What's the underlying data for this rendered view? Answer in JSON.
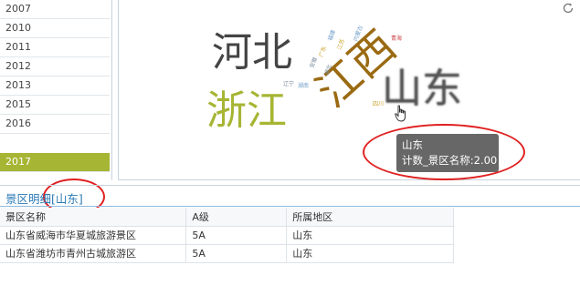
{
  "years": [
    {
      "label": "2007",
      "selected": false
    },
    {
      "label": "2010",
      "selected": false
    },
    {
      "label": "2011",
      "selected": false
    },
    {
      "label": "2012",
      "selected": false
    },
    {
      "label": "2013",
      "selected": false
    },
    {
      "label": "2015",
      "selected": false
    },
    {
      "label": "2016",
      "selected": false
    },
    {
      "label": "2017",
      "selected": true
    }
  ],
  "cloud": {
    "words": {
      "hebei": "河北",
      "zhejiang": "浙江",
      "jiangxi": "江西",
      "shandong": "山东",
      "small_1": "江苏",
      "small_2": "福建",
      "small_3": "广东",
      "small_4": "安徽",
      "small_5": "内蒙古",
      "small_6": "辽宁",
      "small_7": "湖南",
      "small_8": "青海",
      "small_9": "四川",
      "small_10": "湖北"
    },
    "colors": {
      "hebei": "#444444",
      "zhejiang": "#a7b534",
      "jiangxi": "#9a6a12",
      "shandong": "#555555"
    }
  },
  "tooltip": {
    "name": "山东",
    "metric": "计数_景区名称:2.00"
  },
  "detail": {
    "title": "景区明细[山东]",
    "columns": [
      "景区名称",
      "A级",
      "所属地区"
    ],
    "rows": [
      [
        "山东省威海市华夏城旅游景区",
        "5A",
        "山东"
      ],
      [
        "山东省潍坊市青州古城旅游区",
        "5A",
        "山东"
      ]
    ]
  }
}
